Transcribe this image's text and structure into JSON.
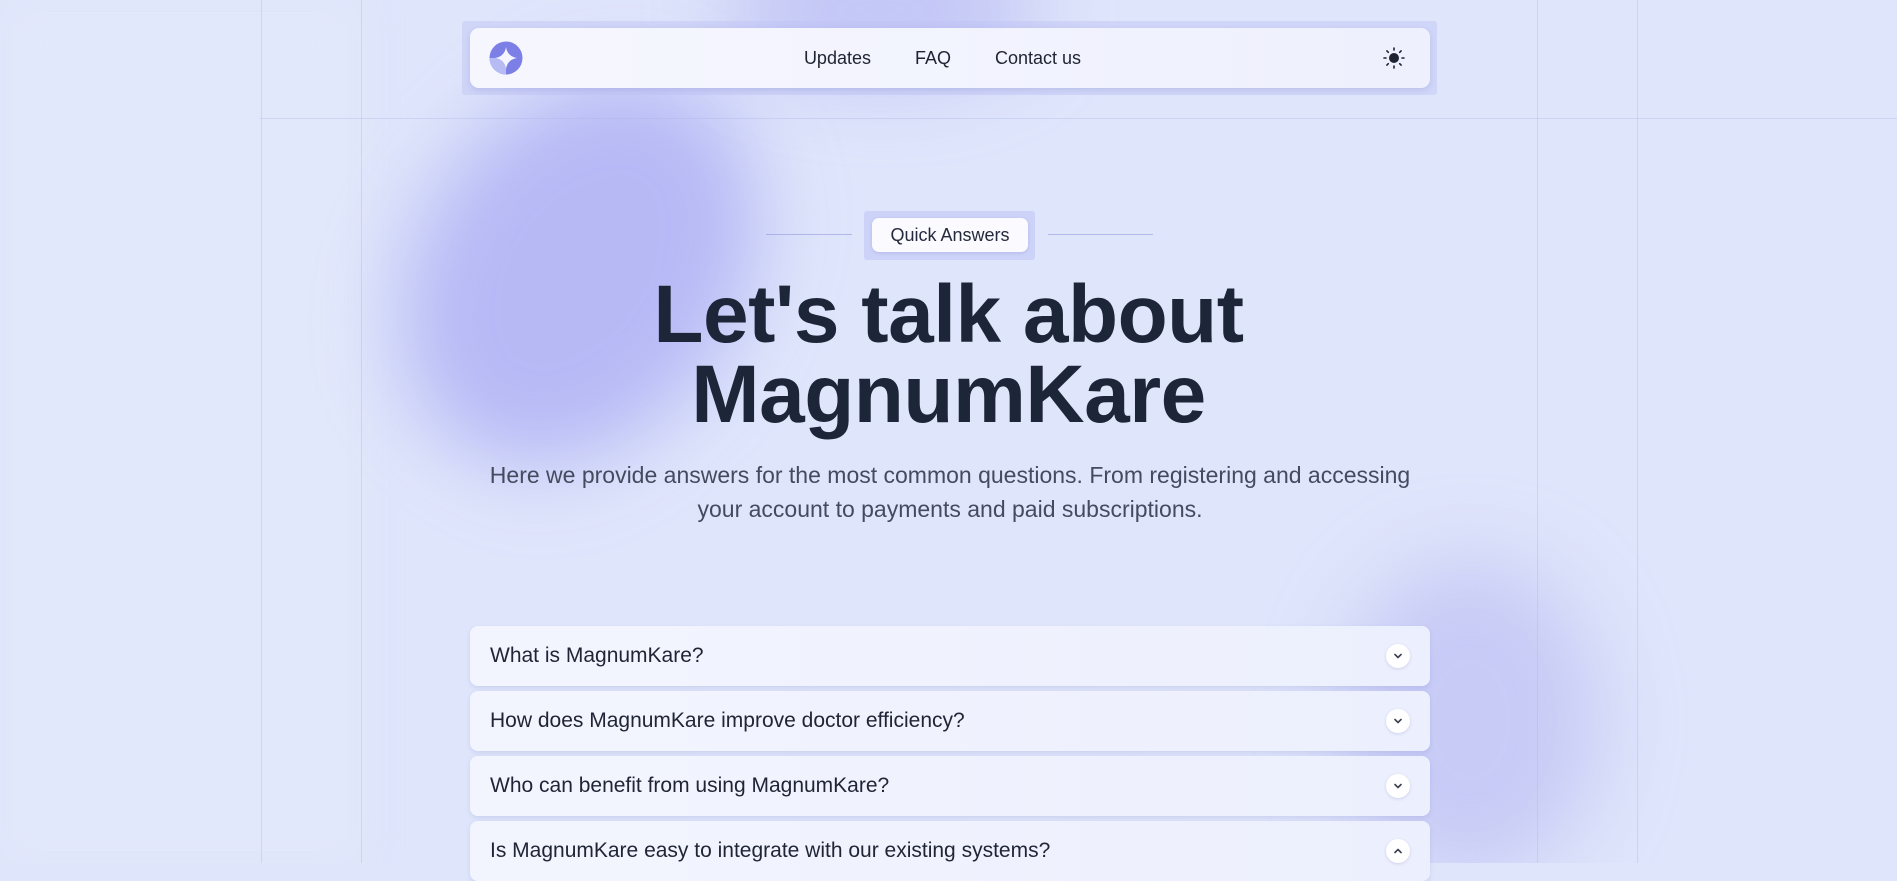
{
  "nav": {
    "links": [
      "Updates",
      "FAQ",
      "Contact us"
    ]
  },
  "hero": {
    "badge": "Quick Answers",
    "title_line1": "Let's talk about",
    "title_line2": "MagnumKare",
    "subtitle_line1": "Here we provide answers for the most common questions. From registering and accessing",
    "subtitle_line2": "your account to payments and paid subscriptions."
  },
  "faq": {
    "items": [
      {
        "question": "What is MagnumKare?",
        "expanded": false
      },
      {
        "question": "How does MagnumKare improve doctor efficiency?",
        "expanded": false
      },
      {
        "question": "Who can benefit from using MagnumKare?",
        "expanded": false
      },
      {
        "question": "Is MagnumKare easy to integrate with our existing systems?",
        "expanded": true
      }
    ]
  },
  "icons": {
    "logo": "brand-logo-icon",
    "theme": "sun-icon",
    "chevron_down": "chevron-down-icon",
    "chevron_up": "chevron-up-icon"
  },
  "colors": {
    "accent": "#7b7fe6",
    "background": "#dfe5fb",
    "text": "#1d2638"
  }
}
